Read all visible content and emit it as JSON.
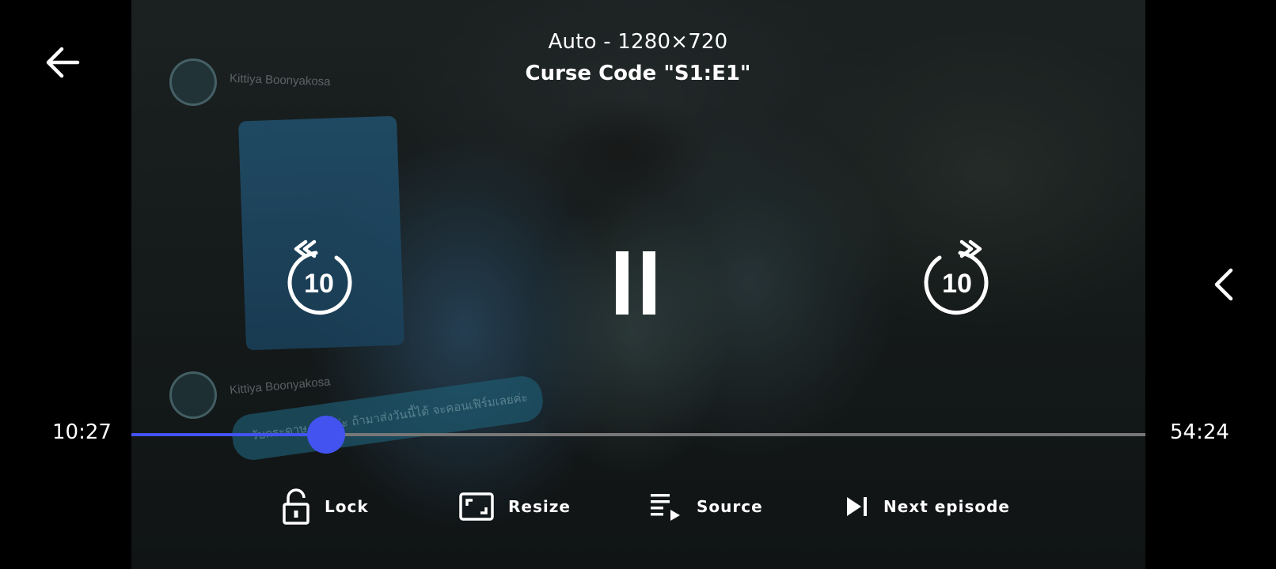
{
  "header": {
    "quality": "Auto - 1280×720",
    "episode_title": "Curse Code \"S1:E1\""
  },
  "video_scene": {
    "chat_name_1": "Kittiya Boonyakosa",
    "chat_name_2": "Kittiya Boonyakosa",
    "chat_caption": "รับกระดาษ ... นี้ค่ะ ถ้ามาส่งวันนี้ได้ จะคอนเฟิร์มเลยค่ะ"
  },
  "controls": {
    "rewind_seconds": "10",
    "forward_seconds": "10",
    "state": "playing"
  },
  "playback": {
    "current_time": "10:27",
    "total_time": "54:24",
    "progress": 0.192,
    "accent_color": "#4353f0"
  },
  "actions": {
    "lock": "Lock",
    "resize": "Resize",
    "source": "Source",
    "next_episode": "Next episode"
  },
  "icons": {
    "back": "arrow-left-icon",
    "side": "chevron-left-icon",
    "rewind": "rewind-10-icon",
    "pause": "pause-icon",
    "forward": "forward-10-icon",
    "lock": "unlock-icon",
    "resize": "resize-icon",
    "source": "playlist-icon",
    "next": "skip-next-icon"
  }
}
